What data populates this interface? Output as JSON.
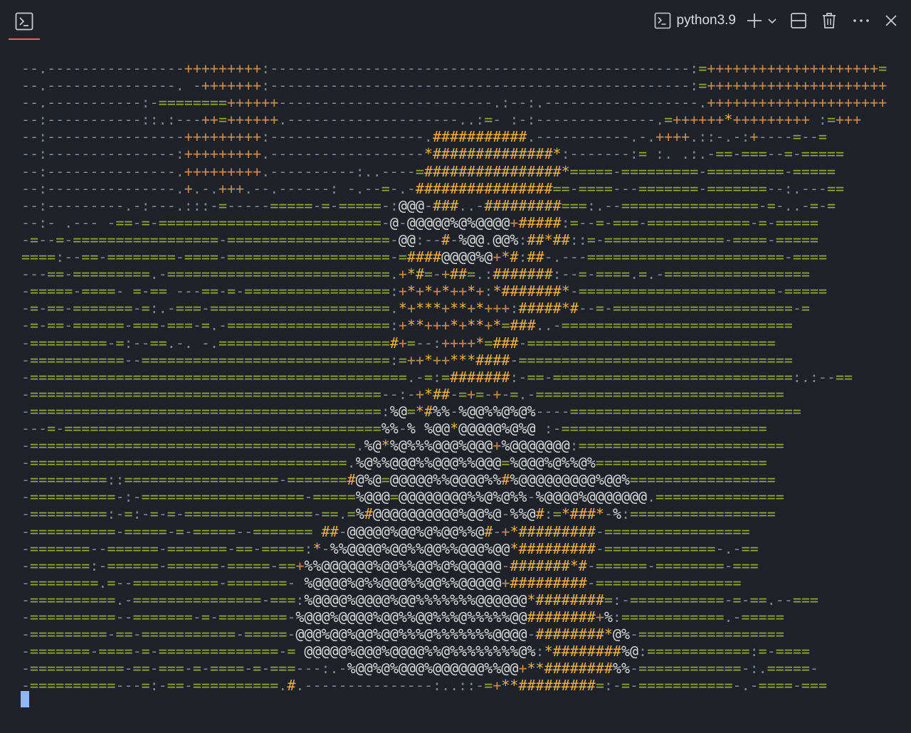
{
  "header": {
    "terminal_tab_icon": "terminal-icon",
    "profile_icon": "terminal-icon",
    "profile_name": "python3.9",
    "actions": [
      "plus-icon",
      "chevron-down-icon",
      "split-icon",
      "trash-icon",
      "more-icon",
      "close-icon"
    ]
  },
  "colors": {
    "background": "#1f2329",
    "dash": "#7d8693",
    "equals": "#95a637",
    "plus": "#c88b4e",
    "hash": "#f2b23d",
    "at": "#d9dbd9",
    "accent_tab": "#e06c50",
    "cursor": "#8fb7f5"
  },
  "output": {
    "lines": [
      "--.----------------+++++++++:-------------------------------------------------:=++++++++++++++++++++=",
      "--.---------------. -+++++++:-------------------------------------------------:=+++++++++++++++++++++",
      "--.-----------:-========++++++-------------------------.:--:.------------------.+++++++++++++++++++++",
      "--:-----------::.:---++=++++++.--------------------..:=- :-:--------------.=++++++*+++++++++ :=+++",
      "--:----------------+++++++++:------------------.###########.-----------.-.++++.::-.-:+----=--=",
      "--:---------------:+++++++++.------------------*##############*:-------:= :. .:.-==-===--=-=====",
      "--:---------------.+++++++++.----------:..----=################*=====-=========-=========-=====",
      "--:---------------.+.-.+++.--.------: -.--=-.-################==-====---=======-=======--:.---==",
      "--:---------.-:---.:::-=-----=====-=-=====-:@@@-###..-#########===:.--================-=-..-=-=",
      "--:- .--- -==-=-==========================-@-@@@@@%@%@@@@+#####:=--=-===-============-=-=====",
      "-=--=-=================-===================-@@:--#-%@@.@@%:##*##::=-==============-====-=====",
      "====:--==-========-====-===================-=####@@@@%@+*#:##-.---=======================-====",
      "---==-=========.-==========================.+*#=-+##=.:#######:--=-====.=.-=================",
      "-=====-====- =-== ---==-=-=================:+*+*+*++*+:*#######*-=======================-=====",
      "-=-==-=======-=:.-===-=====================.*+***+**+*+++:#####*#--=-=====================-=",
      "-=-==-======-===-===-=.-===================:+**+++*+**+*=###..-===========================",
      "-=========-=:--==.-. -.====================#+=--:++++*=###-=============================",
      "-===========--=============================:=++*++***####-================================",
      "-============================================.-=:=#######:-==-============================:.:--==",
      "-=========================================--:-+*##-=+=-+-=.-=============================",
      "-=========================================:%@=*#%%-%@@%%@%@%----===========================",
      "---=-=====================================%%-% %@@*@@@@@%@%@ :-========================",
      "-======================================.%@*%@%%%@@@%@@@+%@@@@@@@:========================",
      "-=====================================.%@%%@@@%%@@@%%@@@=%@@@%@%%@%====================",
      "-=========::==================-=======#@%@=@@@@@%%@@@@%%#%@@@@@@@@@%@@%=================",
      "-==========-:-===================-=====%@@@=@@@@@@@@%%@%@%%-%@@@@%@@@@@@@.===============",
      "-=========:-=:-=-=-===============-==.=%#@@@@@@@@@@%@@%@-%%@#:=*###*-%:=================",
      "-==========-=====-=-=====--======= ##-@@@@@%@@%@%@@%%@#-+*#########-=================",
      "-=======--======-=======-==-=====:*-%%@@@@%@@%%@@%%@@@%@@*#########-=============-.-==",
      "-=======:-======-======-=====-==+%%@@@@@@%@@%%@@%@%@@@@@-#######*#-======-========-===",
      "-========.=--==========-=======- %@@@@%@%%@@@%%@@%%@@@@@+#########-=================",
      "-==========.-===============-===:%@@@@%@@@@%@@%%%%%%%@@@@@@*########=:-===========-=-==.--===",
      "-==========--=======-=-========-%@@@%@@@@%@@%%@@%%%@%%%%%@@########+%:============.-=====",
      "-=========-==-===========-=====-@@@%@@%@@%@@%%%@%%%%%%%@@@@-########*@%-=================",
      "-=======-====-=-==============-= @@@@@%@@@%@@@@%%@%%%%%%%%@%:*########%@:============:=-====",
      "-===========-==-===-=-====-=-===---:.-%@@%@%@@@%@@@@@@%%@@+**########%%-============-:.=====-",
      "-==========---=:-==-==========.#.---------------:..::-=+**#########=:-=-===========-.-====-==="
    ]
  }
}
